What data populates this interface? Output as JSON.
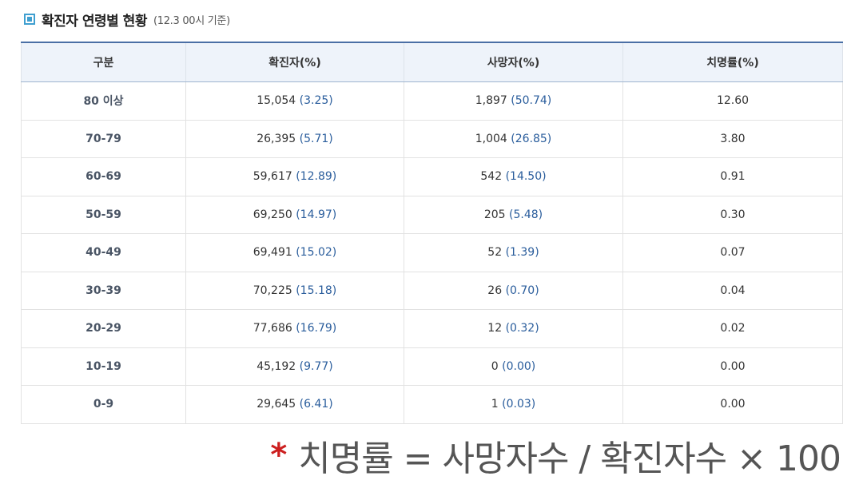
{
  "title": "확진자 연령별 현황",
  "subtitle": "(12.3 00시 기준)",
  "table": {
    "headers": [
      "구분",
      "확진자(%)",
      "사망자(%)",
      "치명률(%)"
    ],
    "rows": [
      {
        "category": "80 이상",
        "confirmed": "15,054",
        "confirmed_pct": "(3.25)",
        "deaths": "1,897",
        "deaths_pct": "(50.74)",
        "fatality_rate": "12.60"
      },
      {
        "category": "70-79",
        "confirmed": "26,395",
        "confirmed_pct": "(5.71)",
        "deaths": "1,004",
        "deaths_pct": "(26.85)",
        "fatality_rate": "3.80"
      },
      {
        "category": "60-69",
        "confirmed": "59,617",
        "confirmed_pct": "(12.89)",
        "deaths": "542",
        "deaths_pct": "(14.50)",
        "fatality_rate": "0.91"
      },
      {
        "category": "50-59",
        "confirmed": "69,250",
        "confirmed_pct": "(14.97)",
        "deaths": "205",
        "deaths_pct": "(5.48)",
        "fatality_rate": "0.30"
      },
      {
        "category": "40-49",
        "confirmed": "69,491",
        "confirmed_pct": "(15.02)",
        "deaths": "52",
        "deaths_pct": "(1.39)",
        "fatality_rate": "0.07"
      },
      {
        "category": "30-39",
        "confirmed": "70,225",
        "confirmed_pct": "(15.18)",
        "deaths": "26",
        "deaths_pct": "(0.70)",
        "fatality_rate": "0.04"
      },
      {
        "category": "20-29",
        "confirmed": "77,686",
        "confirmed_pct": "(16.79)",
        "deaths": "12",
        "deaths_pct": "(0.32)",
        "fatality_rate": "0.02"
      },
      {
        "category": "10-19",
        "confirmed": "45,192",
        "confirmed_pct": "(9.77)",
        "deaths": "0",
        "deaths_pct": "(0.00)",
        "fatality_rate": "0.00"
      },
      {
        "category": "0-9",
        "confirmed": "29,645",
        "confirmed_pct": "(6.41)",
        "deaths": "1",
        "deaths_pct": "(0.03)",
        "fatality_rate": "0.00"
      }
    ]
  },
  "formula": {
    "asterisk": "*",
    "text": "치명률 = 사망자수 / 확진자수 × 100"
  },
  "colors": {
    "accent": "#3f9fd0",
    "header_bg": "#eef3fa",
    "value_blue": "#2a5d9c",
    "asterisk_red": "#cc1f1f"
  }
}
